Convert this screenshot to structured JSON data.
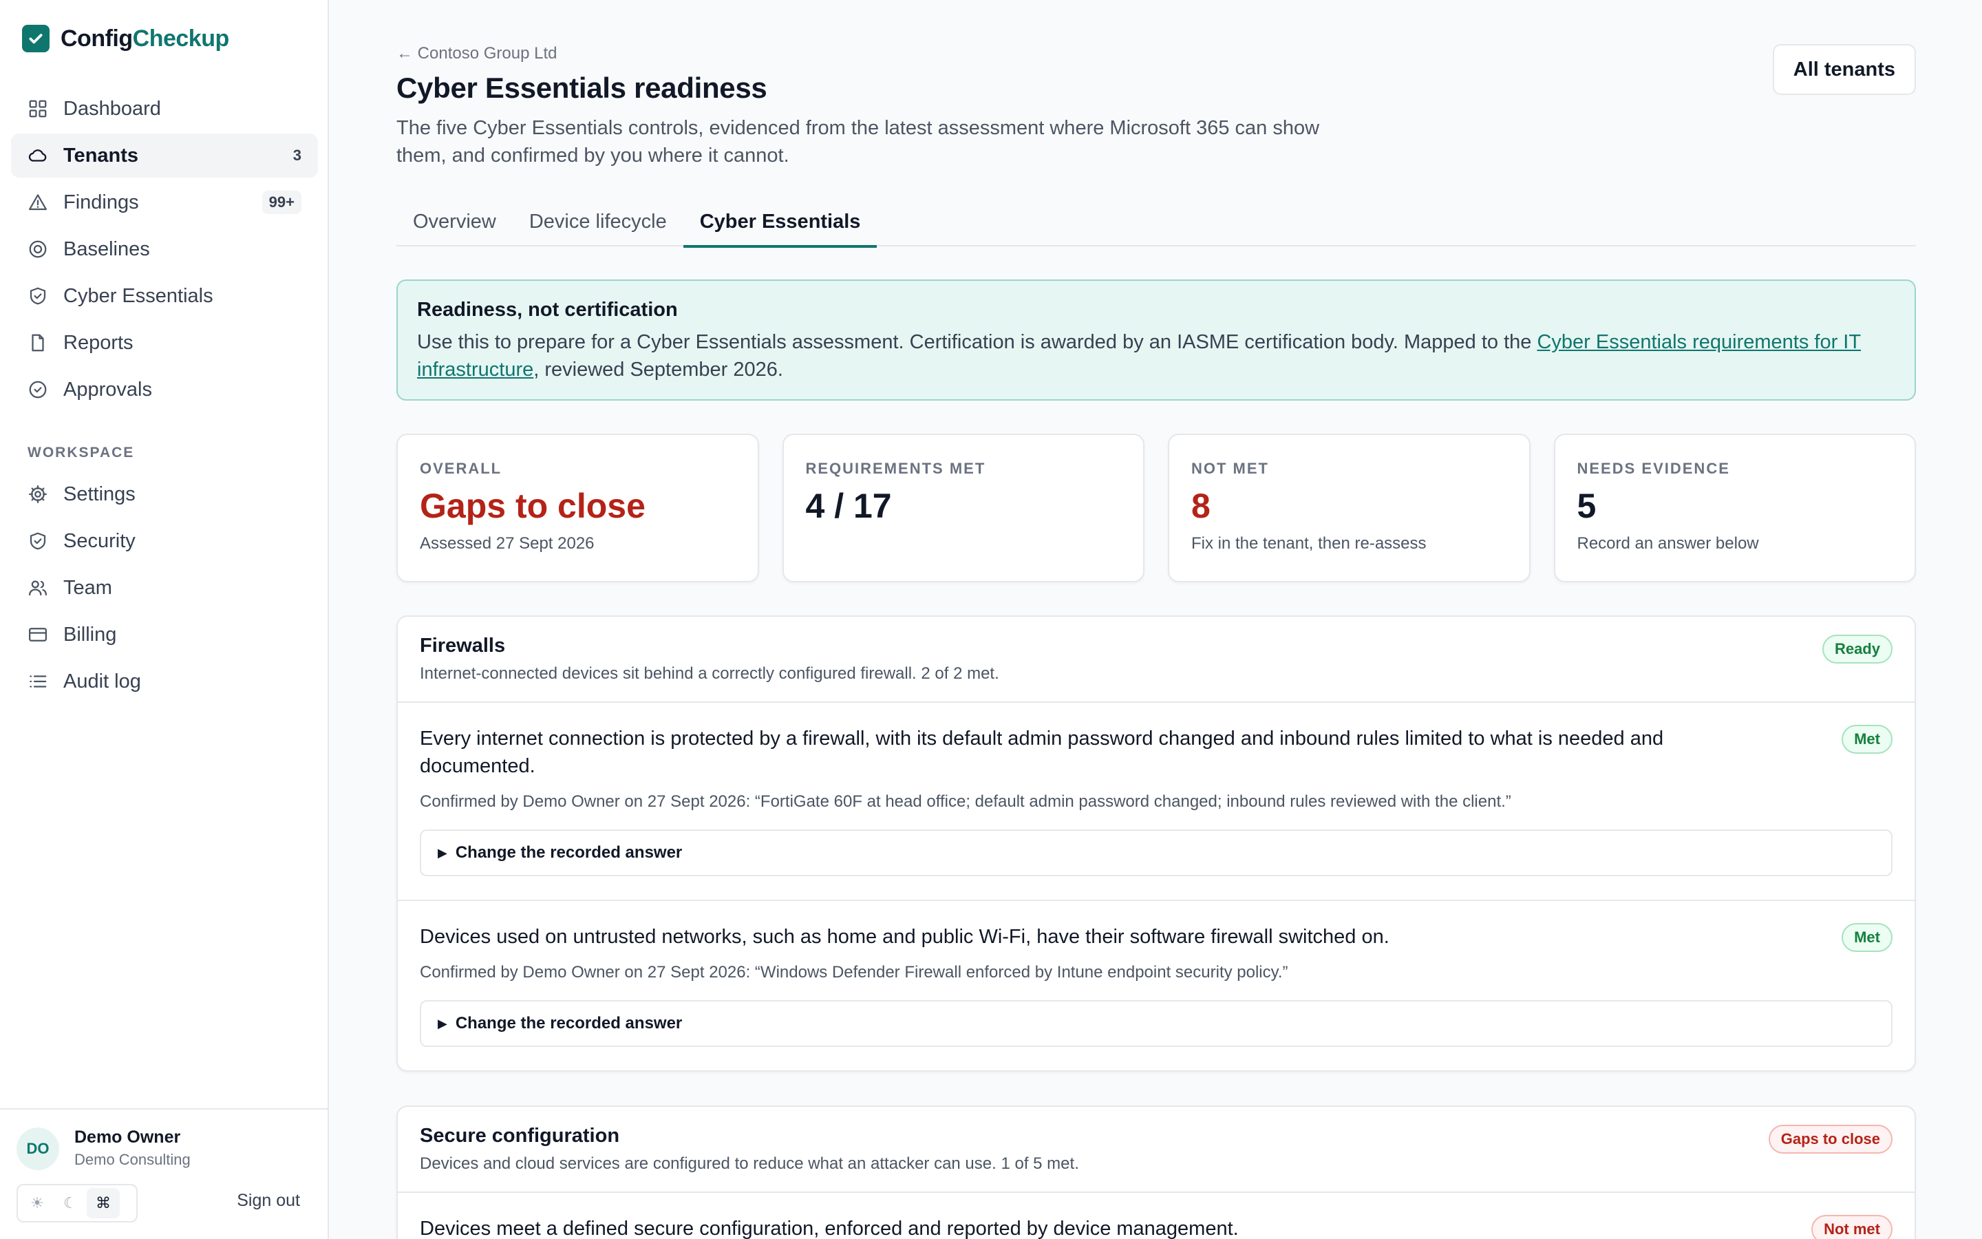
{
  "brand": {
    "part1": "Config",
    "part2": "Checkup"
  },
  "nav": {
    "items": [
      {
        "label": "Dashboard",
        "icon": "grid-icon"
      },
      {
        "label": "Tenants",
        "icon": "cloud-icon",
        "count": "3"
      },
      {
        "label": "Findings",
        "icon": "alert-triangle-icon",
        "count": "99+"
      },
      {
        "label": "Baselines",
        "icon": "target-icon"
      },
      {
        "label": "Cyber Essentials",
        "icon": "shield-check-icon"
      },
      {
        "label": "Reports",
        "icon": "file-icon"
      },
      {
        "label": "Approvals",
        "icon": "check-circle-icon"
      }
    ],
    "section_label": "WORKSPACE",
    "workspace": [
      {
        "label": "Settings",
        "icon": "gear-icon"
      },
      {
        "label": "Security",
        "icon": "shield-check-icon"
      },
      {
        "label": "Team",
        "icon": "users-icon"
      },
      {
        "label": "Billing",
        "icon": "credit-card-icon"
      },
      {
        "label": "Audit log",
        "icon": "list-icon"
      }
    ]
  },
  "user": {
    "initials": "DO",
    "name": "Demo Owner",
    "org": "Demo Consulting",
    "sign_out": "Sign out"
  },
  "theme": {
    "light": "☀",
    "dark": "☾",
    "system": "⌘"
  },
  "header": {
    "breadcrumb": "← Contoso Group Ltd",
    "title": "Cyber Essentials readiness",
    "description": "The five Cyber Essentials controls, evidenced from the latest assessment where Microsoft 365 can show them, and confirmed by you where it cannot.",
    "all_tenants": "All tenants"
  },
  "tabs": [
    "Overview",
    "Device lifecycle",
    "Cyber Essentials"
  ],
  "notice": {
    "title": "Readiness, not certification",
    "text_before": "Use this to prepare for a Cyber Essentials assessment. Certification is awarded by an IASME certification body. Mapped to the ",
    "link": "Cyber Essentials requirements for IT infrastructure",
    "text_after": ", reviewed September 2026."
  },
  "stats": [
    {
      "label": "OVERALL",
      "value": "Gaps to close",
      "sub": "Assessed 27 Sept 2026"
    },
    {
      "label": "REQUIREMENTS MET",
      "value": "4 / 17",
      "sub": ""
    },
    {
      "label": "NOT MET",
      "value": "8",
      "sub": "Fix in the tenant, then re-assess"
    },
    {
      "label": "NEEDS EVIDENCE",
      "value": "5",
      "sub": "Record an answer below"
    }
  ],
  "sections": [
    {
      "title": "Firewalls",
      "desc": "Internet-connected devices sit behind a correctly configured firewall. 2 of 2 met.",
      "badge": "Ready",
      "requirements": [
        {
          "text": "Every internet connection is protected by a firewall, with its default admin password changed and inbound rules limited to what is needed and documented.",
          "badge": "Met",
          "confirm": "Confirmed by Demo Owner on 27 Sept 2026: “FortiGate 60F at head office; default admin password changed; inbound rules reviewed with the client.”",
          "details": "Change the recorded answer"
        },
        {
          "text": "Devices used on untrusted networks, such as home and public Wi-Fi, have their software firewall switched on.",
          "badge": "Met",
          "confirm": "Confirmed by Demo Owner on 27 Sept 2026: “Windows Defender Firewall enforced by Intune endpoint security policy.”",
          "details": "Change the recorded answer"
        }
      ]
    },
    {
      "title": "Secure configuration",
      "desc": "Devices and cloud services are configured to reduce what an attacker can use. 1 of 5 met.",
      "badge": "Gaps to close",
      "requirements": [
        {
          "text": "Devices meet a defined secure configuration, enforced and reported by device management.",
          "badge": "Not met"
        }
      ]
    }
  ],
  "colors": {
    "accent": "#0f766e",
    "danger": "#b42318",
    "success": "#15803d"
  }
}
